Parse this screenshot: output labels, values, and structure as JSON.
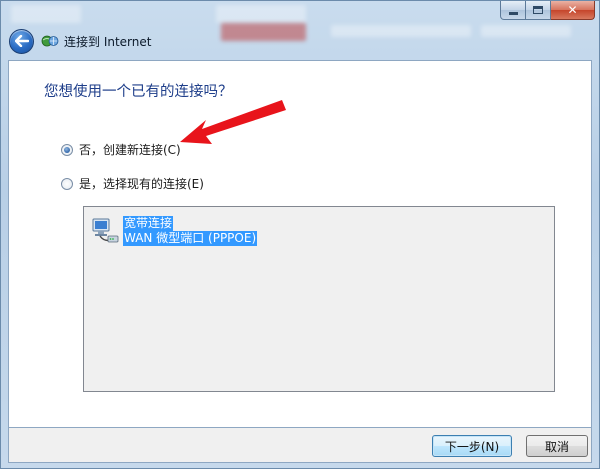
{
  "window": {
    "title": "连接到 Internet"
  },
  "page": {
    "question": "您想使用一个已有的连接吗？",
    "options": [
      {
        "label": "否，创建新连接(C)",
        "selected": true
      },
      {
        "label": "是，选择现有的连接(E)",
        "selected": false
      }
    ],
    "connections": [
      {
        "name": "宽带连接",
        "detail": "WAN 微型端口 (PPPOE)",
        "selected": true
      }
    ]
  },
  "footer": {
    "next_label": "下一步(N)",
    "cancel_label": "取消"
  },
  "annotation": {
    "arrow_color": "#e8141b"
  },
  "colors": {
    "question_text": "#1e3e8a",
    "selection_bg": "#3399ff"
  },
  "icons": {
    "back": "back-arrow-icon",
    "title": "network-globe-icon",
    "connection": "broadband-connection-icon"
  }
}
